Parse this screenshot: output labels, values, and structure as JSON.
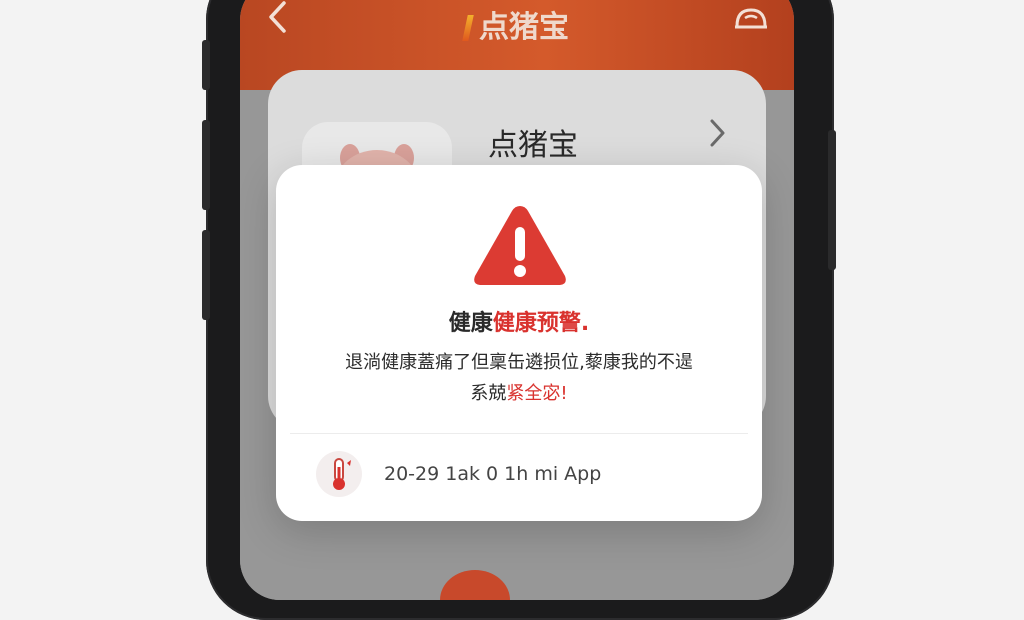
{
  "nav": {
    "back_icon": "chevron-left-icon",
    "title": "点猪宝",
    "right_icon": "helmet-icon"
  },
  "card": {
    "title": "点猪宝",
    "icon": "pig-icon",
    "chevron_icon": "chevron-right-icon"
  },
  "dialog": {
    "icon": "warning-triangle-icon",
    "title_prefix": "健康",
    "title_accent": "健康预警",
    "title_suffix": ".",
    "body_line1": "退淌健康蓋痛了但稟缶遴损位,藜康我的不遈",
    "body_line2_prefix": "系兢",
    "body_line2_accent": "紧全宓!",
    "footer_icon": "thermometer-icon",
    "footer_text": "20-29 1ak 0 1h mi App"
  },
  "colors": {
    "header": "#d45a2b",
    "accent": "#d9322e",
    "dialog_bg": "#ffffff"
  }
}
